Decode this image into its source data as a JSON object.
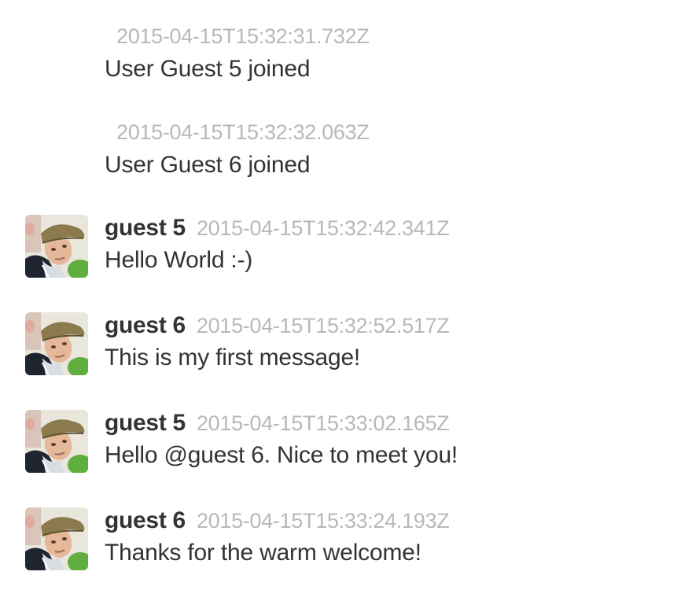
{
  "system_messages": [
    {
      "timestamp": "2015-04-15T15:32:31.732Z",
      "text": "User Guest 5 joined"
    },
    {
      "timestamp": "2015-04-15T15:32:32.063Z",
      "text": "User Guest 6 joined"
    }
  ],
  "messages": [
    {
      "author": "guest 5",
      "timestamp": "2015-04-15T15:32:42.341Z",
      "text": "Hello World :-)",
      "avatar_icon": "user-avatar-icon"
    },
    {
      "author": "guest 6",
      "timestamp": "2015-04-15T15:32:52.517Z",
      "text": "This is my first message!",
      "avatar_icon": "user-avatar-icon"
    },
    {
      "author": "guest 5",
      "timestamp": "2015-04-15T15:33:02.165Z",
      "text": "Hello @guest 6. Nice to meet you!",
      "avatar_icon": "user-avatar-icon"
    },
    {
      "author": "guest 6",
      "timestamp": "2015-04-15T15:33:24.193Z",
      "text": "Thanks for the warm welcome!",
      "avatar_icon": "user-avatar-icon"
    }
  ],
  "colors": {
    "text": "#333333",
    "timestamp": "#b8b8b8",
    "background": "#ffffff"
  }
}
